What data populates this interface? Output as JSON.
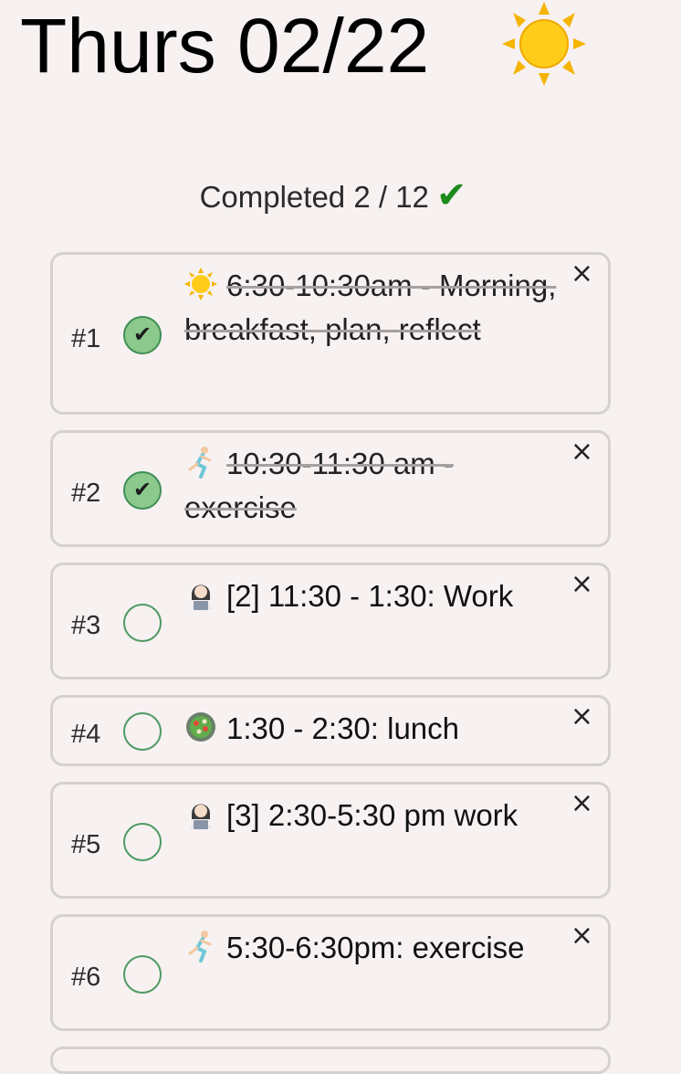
{
  "header": {
    "title": "Thurs 02/22",
    "title_icon": "sun-icon"
  },
  "summary": {
    "label": "Completed 2 / 12",
    "check_glyph": "✔"
  },
  "tasks": [
    {
      "number": "#1",
      "text": "6:30-10:30am - Morning, breakfast, plan, reflect",
      "done": true,
      "icon": "sun-icon"
    },
    {
      "number": "#2",
      "text": "10:30-11:30 am - exercise",
      "done": true,
      "icon": "runner-icon"
    },
    {
      "number": "#3",
      "text": "[2] 11:30 - 1:30: Work",
      "done": false,
      "icon": "technologist-icon"
    },
    {
      "number": "#4",
      "text": "1:30 - 2:30: lunch",
      "done": false,
      "icon": "salad-icon"
    },
    {
      "number": "#5",
      "text": "[3] 2:30-5:30 pm work",
      "done": false,
      "icon": "technologist-icon"
    },
    {
      "number": "#6",
      "text": "5:30-6:30pm: exercise",
      "done": false,
      "icon": "runner-icon"
    }
  ],
  "close_glyph": "×",
  "colors": {
    "background": "#f7f1f1",
    "card_border": "#d6d0d0",
    "check_fill": "#8cc98c",
    "check_border": "#4f9a63",
    "accent_green": "#1d8a1d"
  }
}
